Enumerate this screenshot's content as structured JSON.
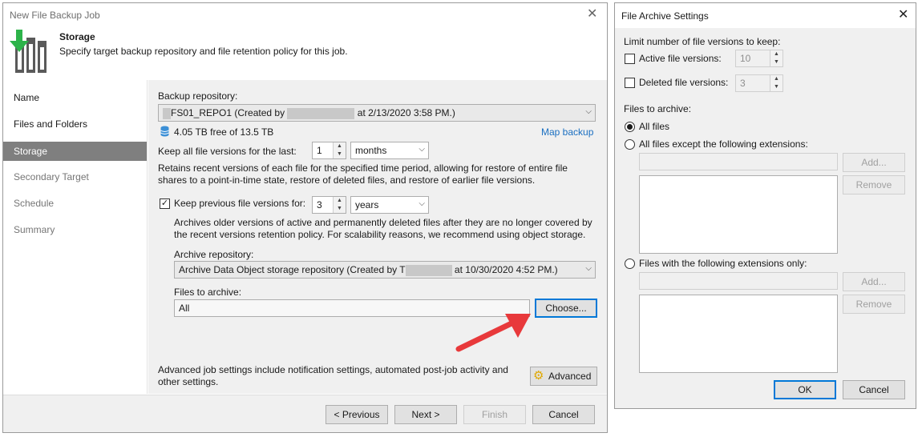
{
  "wizard": {
    "title": "New File Backup Job",
    "header": {
      "title": "Storage",
      "description": "Specify target backup repository and file retention policy for this job."
    },
    "nav": [
      "Name",
      "Files and Folders",
      "Storage",
      "Secondary Target",
      "Schedule",
      "Summary"
    ],
    "nav_selected": "Storage",
    "backup_repository_label": "Backup repository:",
    "backup_repository_value_a": "FS01_REPO1 (Created by",
    "backup_repository_value_b": "at 2/13/2020 3:58 PM.)",
    "free_space": "4.05 TB free of 13.5 TB",
    "map_backup": "Map backup",
    "keep_all_label": "Keep all file versions for the last:",
    "keep_all_value": "1",
    "keep_all_unit": "months",
    "keep_all_desc": "Retains recent versions of each file for the specified time period, allowing for restore of entire file shares to a point-in-time state, restore of deleted files, and restore of earlier file versions.",
    "keep_prev_label": "Keep previous file versions for:",
    "keep_prev_checked": true,
    "keep_prev_value": "3",
    "keep_prev_unit": "years",
    "keep_prev_desc": "Archives older versions of active and permanently deleted files after they are no longer covered by the recent versions retention policy. For scalability reasons, we recommend using object storage.",
    "archive_repo_label": "Archive repository:",
    "archive_repo_value_a": "Archive Data Object storage repository (Created by T",
    "archive_repo_value_b": "at 10/30/2020 4:52 PM.)",
    "files_to_archive_label": "Files to archive:",
    "files_to_archive_value": "All",
    "choose_btn": "Choose...",
    "advanced_desc": "Advanced job settings include notification settings, automated post-job activity and other settings.",
    "advanced_btn": "Advanced",
    "footer": {
      "previous": "< Previous",
      "next": "Next >",
      "finish": "Finish",
      "cancel": "Cancel"
    }
  },
  "dialog": {
    "title": "File Archive Settings",
    "limit_label": "Limit number of file versions to keep:",
    "active_label": "Active file versions:",
    "active_value": "10",
    "deleted_label": "Deleted file versions:",
    "deleted_value": "3",
    "files_to_archive_label": "Files to archive:",
    "opt_all": "All files",
    "opt_except": "All files except the following extensions:",
    "opt_only": "Files with the following extensions only:",
    "selected_option": "All files",
    "add_btn": "Add...",
    "remove_btn": "Remove",
    "ok_btn": "OK",
    "cancel_btn": "Cancel"
  },
  "colors": {
    "accent": "#0078d7",
    "link": "#1a6fc1",
    "nav_selected": "#7f7f7f",
    "arrow": "#e8393b"
  }
}
